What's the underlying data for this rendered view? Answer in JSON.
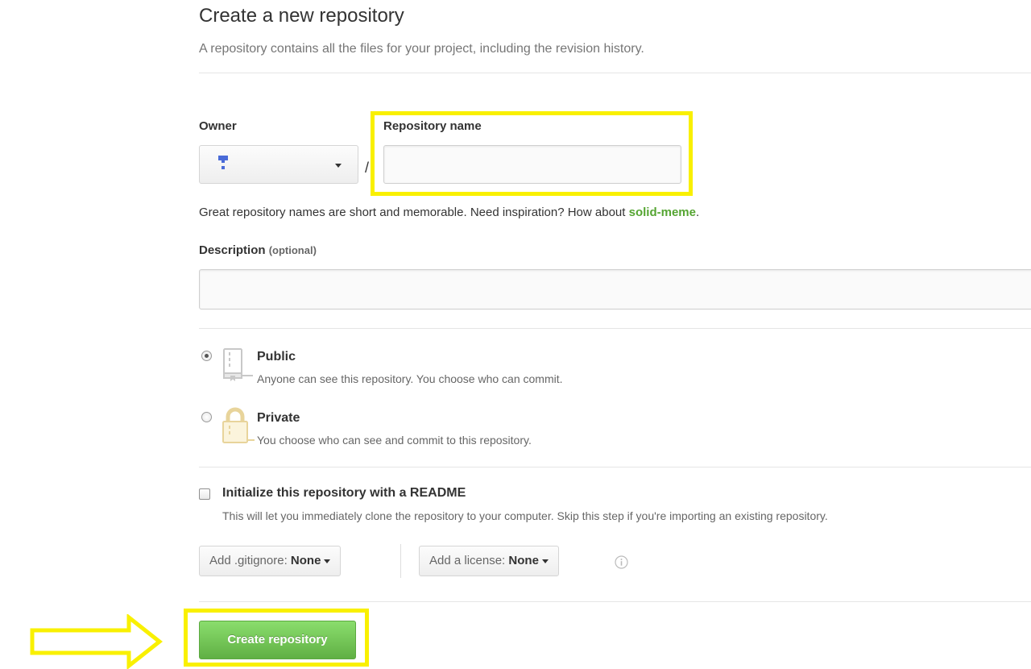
{
  "header": {
    "title": "Create a new repository",
    "subtitle": "A repository contains all the files for your project, including the revision history."
  },
  "owner": {
    "label": "Owner",
    "separator": "/"
  },
  "repository": {
    "label": "Repository name",
    "value": "",
    "hint_text": "Great repository names are short and memorable. Need inspiration? How about ",
    "suggestion": "solid-meme",
    "hint_end": "."
  },
  "description": {
    "label": "Description",
    "optional": "(optional)",
    "value": ""
  },
  "visibility": {
    "selected": "public",
    "public": {
      "title": "Public",
      "description": "Anyone can see this repository. You choose who can commit.",
      "icon": "repo-book-icon"
    },
    "private": {
      "title": "Private",
      "description": "You choose who can see and commit to this repository.",
      "icon": "lock-icon"
    }
  },
  "readme": {
    "checked": false,
    "title": "Initialize this repository with a README",
    "description": "This will let you immediately clone the repository to your computer. Skip this step if you're importing an existing repository."
  },
  "gitignore": {
    "label": "Add .gitignore:",
    "value": "None"
  },
  "license": {
    "label": "Add a license:",
    "value": "None"
  },
  "submit": {
    "label": "Create repository"
  },
  "colors": {
    "highlight": "#f9f000",
    "accent_green": "#55a532",
    "button_green": "#60b044"
  }
}
